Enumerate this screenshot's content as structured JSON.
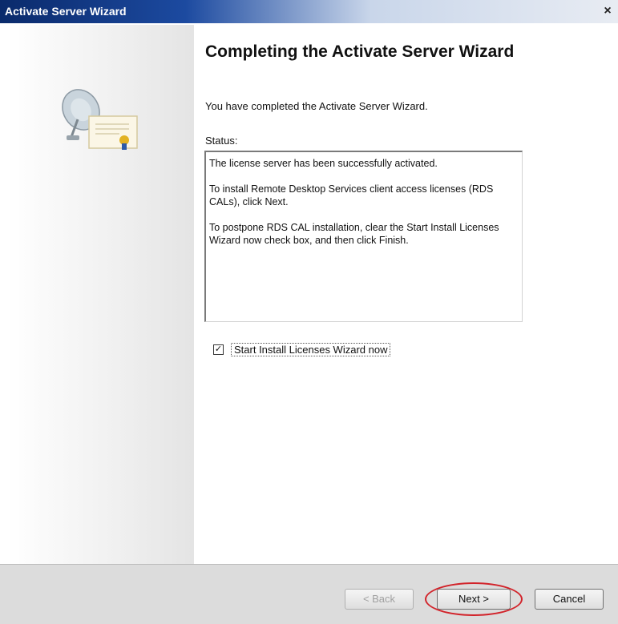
{
  "window": {
    "title": "Activate Server Wizard",
    "close_glyph": "×"
  },
  "main": {
    "heading": "Completing the Activate Server Wizard",
    "subtext": "You have completed the Activate Server Wizard.",
    "status_label": "Status:",
    "status_lines": [
      "The license server has been successfully activated.",
      "To install Remote Desktop Services client access licenses (RDS CALs), click Next.",
      "To postpone RDS CAL installation, clear the Start Install Licenses Wizard now check box, and then click Finish."
    ],
    "checkbox": {
      "label": "Start Install Licenses Wizard now",
      "checked": true,
      "check_glyph": "✓"
    }
  },
  "footer": {
    "back_label": "< Back",
    "next_label": "Next >",
    "cancel_label": "Cancel"
  },
  "colors": {
    "highlight": "#d2232a",
    "title_bar_start": "#0a2a6b"
  },
  "icons": {
    "wizard_graphic": "satellite-dish-certificate-icon"
  }
}
